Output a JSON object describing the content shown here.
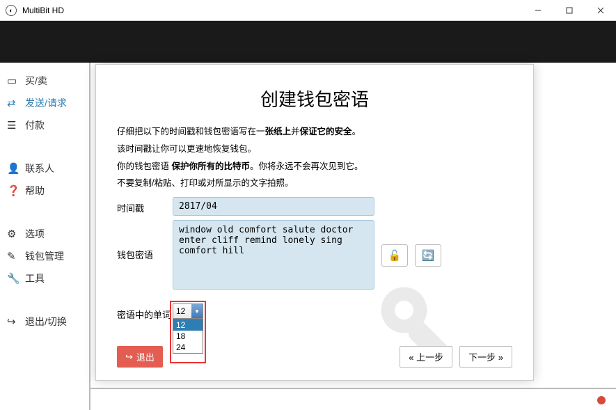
{
  "window": {
    "title": "MultiBit HD"
  },
  "sidebar": {
    "items": [
      {
        "label": "买/卖"
      },
      {
        "label": "发送/请求"
      },
      {
        "label": "付款"
      },
      {
        "label": "联系人"
      },
      {
        "label": "帮助"
      },
      {
        "label": "选项"
      },
      {
        "label": "钱包管理"
      },
      {
        "label": "工具"
      },
      {
        "label": "退出/切换"
      }
    ]
  },
  "modal": {
    "title": "创建钱包密语",
    "line1a": "仔细把以下的时间戳和钱包密语写在一",
    "line1b": "张纸上",
    "line1c": "并",
    "line1d": "保证它的安全",
    "line1e": "。",
    "line2": "该时间戳让你可以更速地恢复钱包。",
    "line3a": "你的钱包密语",
    "line3b": " 保护你所有的比特币",
    "line3c": "。你将永远不会再次见到它。",
    "line4": "不要复制/粘贴、打印或对所显示的文字拍照。",
    "timestamp_label": "时间戳",
    "timestamp_value": "2817/04",
    "seed_label": "钱包密语",
    "seed_value": "window old comfort salute doctor enter cliff remind lonely sing comfort hill",
    "wordcount_label": "密语中的单词",
    "wordcount_value": "12",
    "options": [
      "12",
      "18",
      "24"
    ],
    "exit": "退出",
    "prev": "上一步",
    "next": "下一步"
  }
}
